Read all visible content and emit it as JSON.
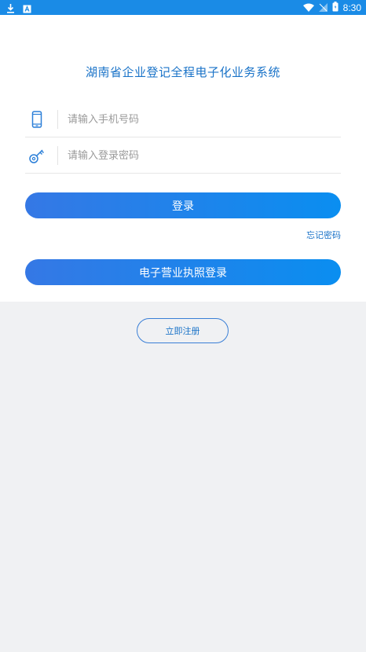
{
  "status_bar": {
    "time": "8:30",
    "left_icons": [
      "download-icon",
      "a-notification-icon"
    ],
    "right_icons": [
      "wifi-icon",
      "no-signal-icon",
      "battery-icon"
    ]
  },
  "app": {
    "title": "湖南省企业登记全程电子化业务系统"
  },
  "login_form": {
    "phone_placeholder": "请输入手机号码",
    "password_placeholder": "请输入登录密码",
    "login_label": "登录",
    "forgot_label": "忘记密码",
    "license_login_label": "电子营业执照登录"
  },
  "register": {
    "label": "立即注册"
  },
  "colors": {
    "accent": "#1a8be6",
    "button_start": "#3578e5",
    "button_end": "#0a8ef0",
    "link": "#1a73c8",
    "background": "#f0f1f3"
  }
}
